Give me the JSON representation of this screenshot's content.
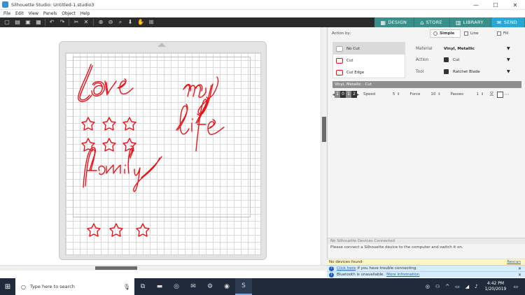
{
  "window": {
    "title": "Silhouette Studio: Untitled-1.studio3",
    "minimize": "—",
    "maximize": "☐",
    "close": "✕"
  },
  "menu": [
    "File",
    "Edit",
    "View",
    "Panels",
    "Object",
    "Help"
  ],
  "tabs": [
    {
      "label": "DESIGN",
      "icon": "grid-icon"
    },
    {
      "label": "STORE",
      "icon": "store-icon"
    },
    {
      "label": "LIBRARY",
      "icon": "library-icon"
    },
    {
      "label": "SEND",
      "icon": "send-icon"
    }
  ],
  "artwork": {
    "words": [
      "love",
      "my",
      "life",
      "family"
    ],
    "stroke_color": "#e8141c"
  },
  "send_panel": {
    "action_by_label": "Action by:",
    "modes": {
      "simple": "Simple",
      "line": "Line",
      "fill": "Fill"
    },
    "cut_options": [
      "No Cut",
      "Cut",
      "Cut Edge"
    ],
    "material_label": "Material",
    "material_value": "Vinyl, Metallic",
    "action_label": "Action",
    "action_value": "Cut",
    "tool_label": "Tool",
    "tool_value": "Ratchet Blade",
    "settings_header": "Vinyl, Metallic : Cut",
    "blade_digits": [
      "1",
      "0",
      "1",
      "2"
    ],
    "speed_label": "Speed",
    "speed_value": "5",
    "force_label": "Force",
    "force_value": "10",
    "passes_label": "Passes",
    "passes_value": "1",
    "devices_header": "No Silhouette Devices Connected",
    "devices_message": "Please connect a Silhouette device to the computer and switch it on."
  },
  "status": {
    "no_devices": "No devices found",
    "rescan": "Rescan",
    "help_link": "Click here",
    "help_text": " if you have trouble connecting.",
    "bluetooth_text": "Bluetooth is unavailable.",
    "bluetooth_link": "More information"
  },
  "taskbar": {
    "search_placeholder": "Type here to search",
    "time": "4:42 PM",
    "date": "1/20/2019"
  },
  "colors": {
    "toolbar_bg": "#2b2b2b",
    "tab_teal": "#3a8f8a",
    "send_blue": "#29a7d6",
    "cut_red": "#e8141c"
  }
}
